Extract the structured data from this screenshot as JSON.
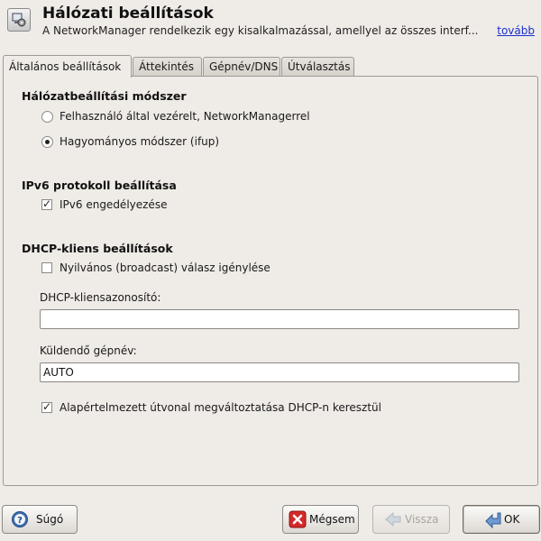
{
  "header": {
    "title": "Hálózati beállítások",
    "subtitle": "A NetworkManager rendelkezik egy kisalkalmazással, amellyel az összes interf...",
    "more_link": "tovább"
  },
  "tabs": [
    {
      "label": "Általános beállítások",
      "active": true
    },
    {
      "label": "Áttekintés",
      "active": false
    },
    {
      "label": "Gépnév/DNS",
      "active": false
    },
    {
      "label": "Útválasztás",
      "active": false
    }
  ],
  "network_method": {
    "heading": "Hálózatbeállítási módszer",
    "options": [
      {
        "label": "Felhasználó által vezérelt, NetworkManagerrel",
        "selected": false
      },
      {
        "label": "Hagyományos módszer (ifup)",
        "selected": true
      }
    ]
  },
  "ipv6": {
    "heading": "IPv6 protokoll beállítása",
    "enable_label": "IPv6 engedélyezése",
    "enabled": true
  },
  "dhcp": {
    "heading": "DHCP-kliens beállítások",
    "broadcast_label": "Nyilvános (broadcast) válasz igénylése",
    "broadcast_checked": false,
    "client_id_label": "DHCP-kliensazonosító:",
    "client_id_value": "",
    "hostname_label": "Küldendő gépnév:",
    "hostname_value": "AUTO",
    "default_route_label": "Alapértelmezett útvonal megváltoztatása DHCP-n keresztül",
    "default_route_checked": true
  },
  "buttons": {
    "help": "Súgó",
    "cancel": "Mégsem",
    "back": "Vissza",
    "ok": "OK"
  }
}
